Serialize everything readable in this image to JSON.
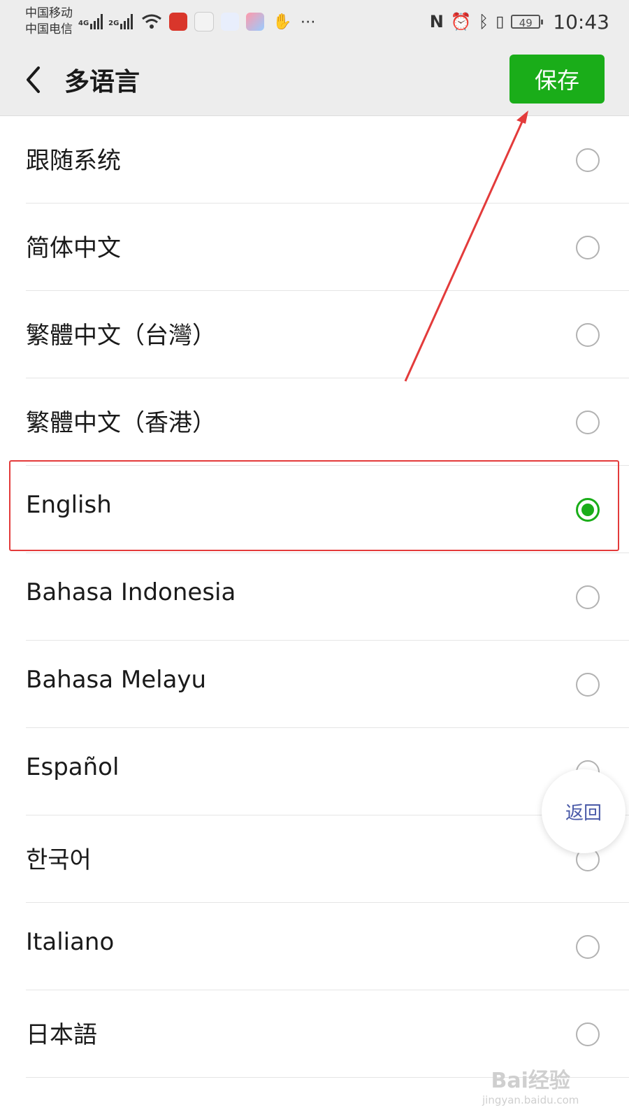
{
  "status_bar": {
    "carrier_1": "中国移动",
    "carrier_2": "中国电信",
    "network_1": "4G",
    "network_2": "2G",
    "battery": "49",
    "time": "10:43"
  },
  "nav": {
    "title": "多语言",
    "save_label": "保存"
  },
  "languages": [
    {
      "label": "跟随系统",
      "selected": false
    },
    {
      "label": "简体中文",
      "selected": false
    },
    {
      "label": "繁體中文（台灣）",
      "selected": false
    },
    {
      "label": "繁體中文（香港）",
      "selected": false
    },
    {
      "label": "English",
      "selected": true
    },
    {
      "label": "Bahasa Indonesia",
      "selected": false
    },
    {
      "label": "Bahasa Melayu",
      "selected": false
    },
    {
      "label": "Español",
      "selected": false
    },
    {
      "label": "한국어",
      "selected": false
    },
    {
      "label": "Italiano",
      "selected": false
    },
    {
      "label": "日本語",
      "selected": false
    }
  ],
  "floating_button": {
    "label": "返回"
  },
  "watermark": {
    "line1": "Bai经验",
    "line2": "jingyan.baidu.com"
  },
  "colors": {
    "accent_green": "#1aad19",
    "annotation_red": "#e33b3b"
  }
}
